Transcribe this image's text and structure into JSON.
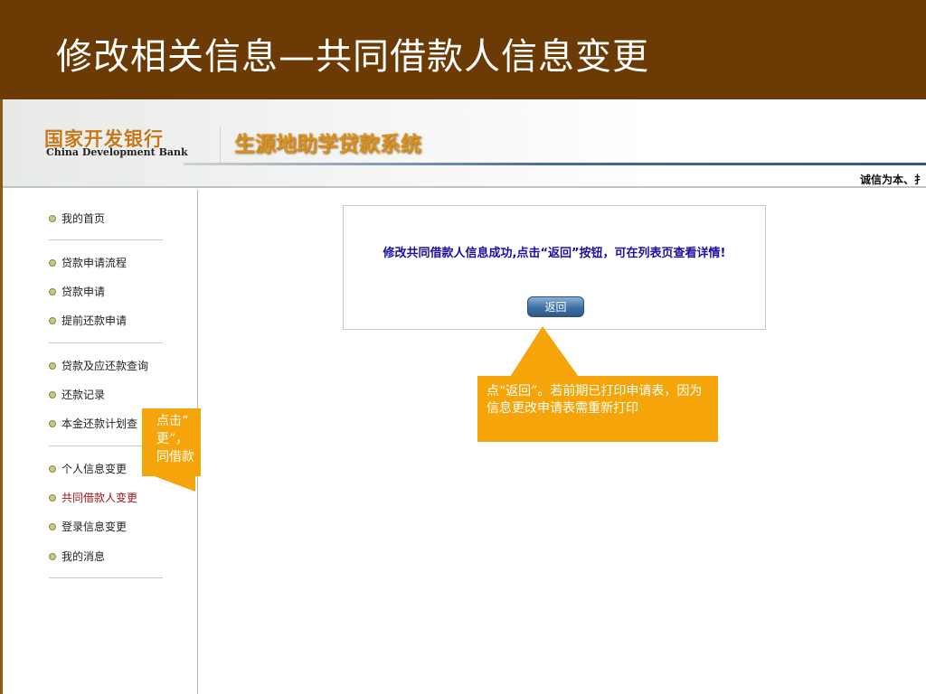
{
  "slide_title": "修改相关信息—共同借款人信息变更",
  "banner": {
    "bank_name_cn": "国家开发银行",
    "bank_name_en": "China Development Bank",
    "system_name": "生源地助学贷款系统",
    "motto": "诚信为本、扌"
  },
  "sidebar": {
    "items": [
      {
        "label": "我的首页"
      },
      {
        "label": "贷款申请流程"
      },
      {
        "label": "贷款申请"
      },
      {
        "label": "提前还款申请"
      },
      {
        "label": "贷款及应还款查询"
      },
      {
        "label": "还款记录"
      },
      {
        "label": "本金还款计划查"
      },
      {
        "label": "个人信息变更"
      },
      {
        "label": "共同借款人变更"
      },
      {
        "label": "登录信息变更"
      },
      {
        "label": "我的消息"
      }
    ]
  },
  "message": {
    "text": "修改共同借款人信息成功,点击“返回”按钮，可在列表页查看详情!",
    "return_button": "返回"
  },
  "callouts": {
    "return_note": "点“返回”。若前期已打印申请表，因为信息更改申请表需重新打印",
    "sidebar_note_lines": [
      "点击“",
      "更”，",
      "同借款"
    ]
  },
  "colors": {
    "title_bar": "#6b3a05",
    "callout": "#f5a50a",
    "message": "#1a10a0",
    "active_nav": "#a01818"
  }
}
